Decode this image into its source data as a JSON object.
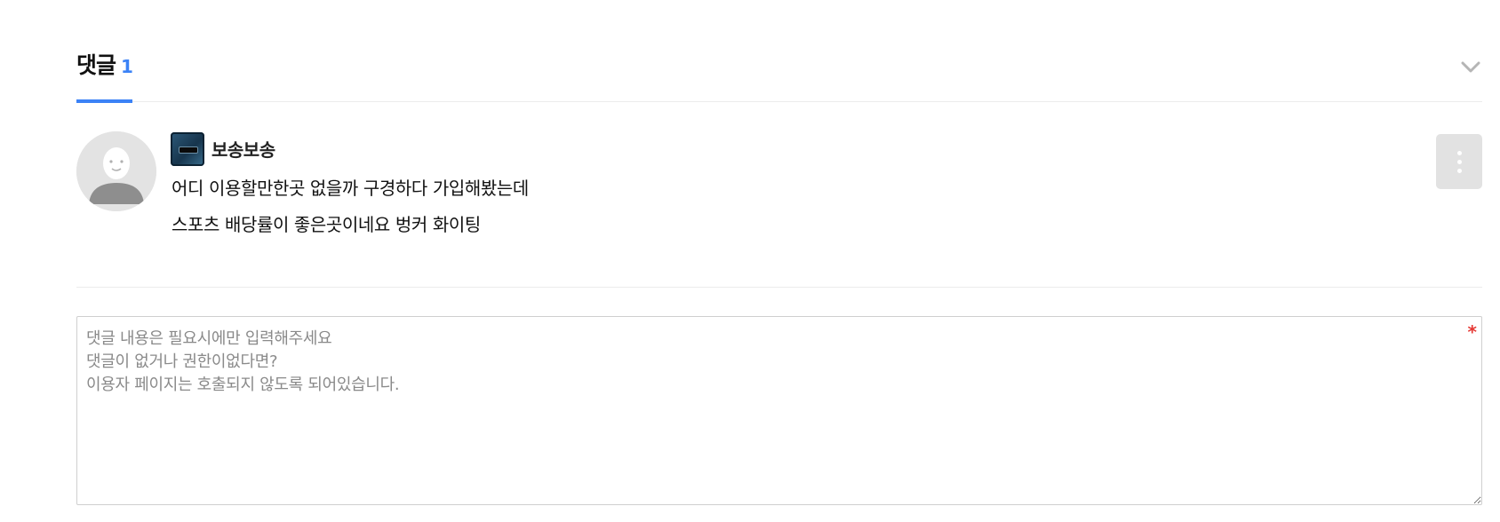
{
  "comments_section": {
    "title": "댓글",
    "count": "1",
    "accent_color": "#3b82f6",
    "collapse_icon": "chevron-down-icon"
  },
  "comment": {
    "avatar_icon": "default-avatar-icon",
    "badge_icon": "level-badge-icon",
    "nickname": "보송보송",
    "lines": [
      "어디 이용할만한곳 없을까 구경하다 가입해봤는데",
      "스포츠 배당률이 좋은곳이네요 벙커 화이팅"
    ],
    "more_icon": "more-vertical-icon"
  },
  "reply_form": {
    "value": "",
    "placeholder": "댓글 내용은 필요시에만 입력해주세요\n댓글이 없거나 권한이없다면?\n이용자 페이지는 호출되지 않도록 되어있습니다.",
    "required_mark": "*",
    "required_color": "#e53935"
  }
}
